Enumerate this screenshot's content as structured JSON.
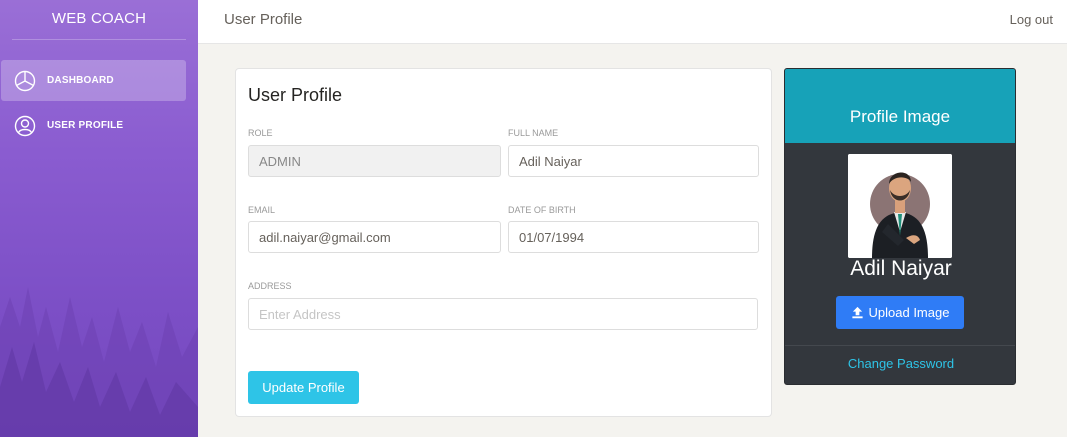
{
  "brand": "WEB COACH",
  "sidebar": {
    "items": [
      {
        "label": "DASHBOARD",
        "icon": "pie-chart-icon",
        "active": true
      },
      {
        "label": "USER PROFILE",
        "icon": "user-circle-icon",
        "active": false
      }
    ]
  },
  "topbar": {
    "title": "User Profile",
    "logout": "Log out"
  },
  "form": {
    "title": "User Profile",
    "role": {
      "label": "ROLE",
      "value": "ADMIN"
    },
    "full_name": {
      "label": "FULL NAME",
      "value": "Adil Naiyar"
    },
    "email": {
      "label": "EMAIL",
      "value": "adil.naiyar@gmail.com"
    },
    "dob": {
      "label": "DATE OF BIRTH",
      "value": "01/07/1994"
    },
    "address": {
      "label": "ADDRESS",
      "value": "",
      "placeholder": "Enter Address"
    },
    "submit": "Update Profile"
  },
  "profile_card": {
    "title": "Profile Image",
    "name": "Adil Naiyar",
    "upload": "Upload Image",
    "change_password": "Change Password"
  },
  "colors": {
    "sidebar": "#8a5cd0",
    "accent_cyan": "#2ec4e7",
    "card_header": "#17a2b8",
    "upload_blue": "#2f7cf6",
    "card_dark": "#33373d"
  }
}
